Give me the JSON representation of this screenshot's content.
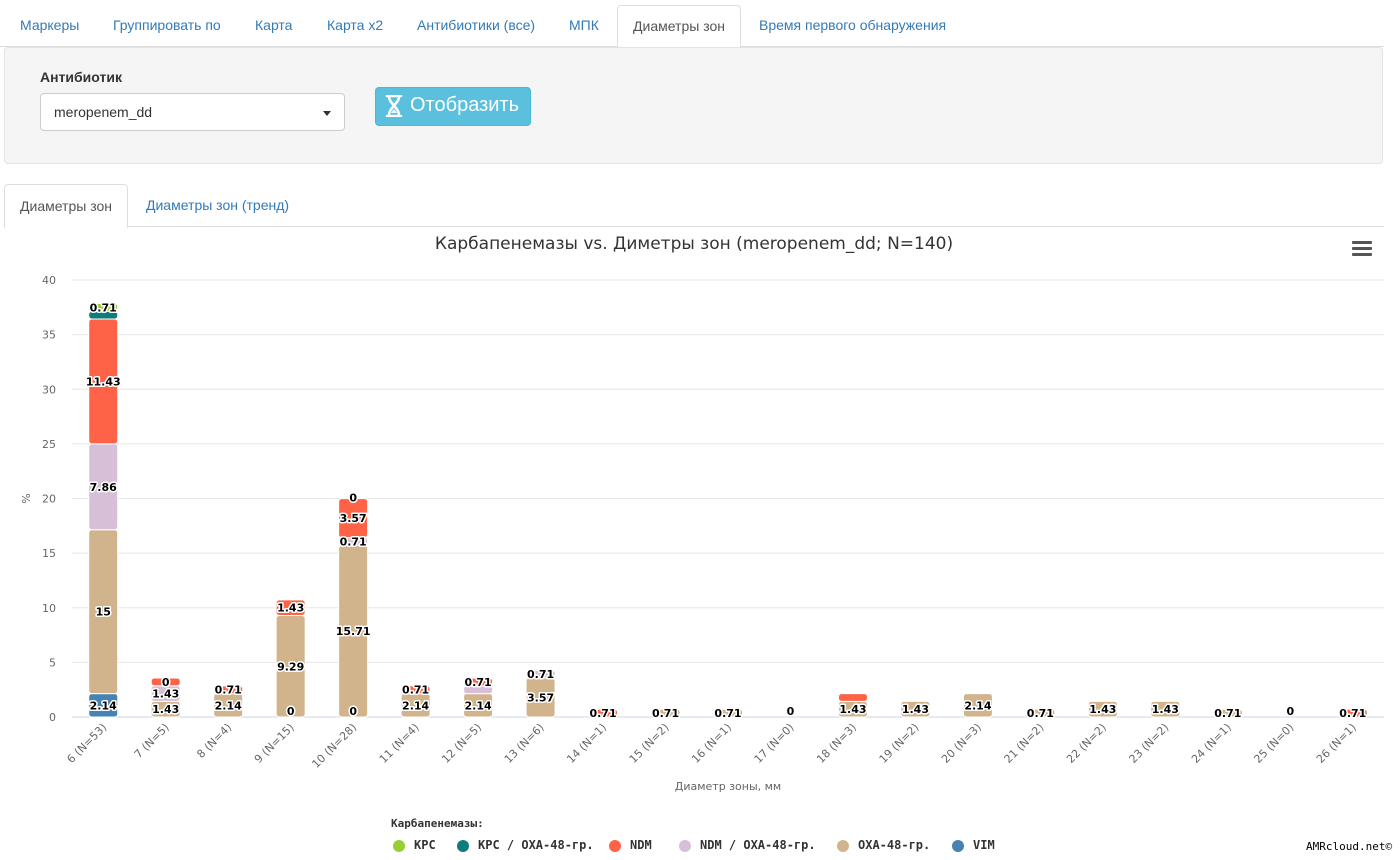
{
  "top_tabs": [
    {
      "label": "Маркеры",
      "active": false
    },
    {
      "label": "Группировать по",
      "active": false
    },
    {
      "label": "Карта",
      "active": false
    },
    {
      "label": "Карта х2",
      "active": false
    },
    {
      "label": "Антибиотики (все)",
      "active": false
    },
    {
      "label": "МПК",
      "active": false
    },
    {
      "label": "Диаметры зон",
      "active": true
    },
    {
      "label": "Время первого обнаружения",
      "active": false
    }
  ],
  "panel": {
    "antibiotic_label": "Антибиотик",
    "antibiotic_value": "meropenem_dd",
    "show_button_label": "Отобразить",
    "show_button_icon": "hourglass-icon"
  },
  "sub_tabs": [
    {
      "label": "Диаметры зон",
      "active": true
    },
    {
      "label": "Диаметры зон (тренд)",
      "active": false
    }
  ],
  "menu_icon": "hamburger-menu-icon",
  "credits": "AMRcloud.net©",
  "chart_data": {
    "type": "bar",
    "stacked": true,
    "title": "Карбапенемазы vs. Диметры зон (meropenem_dd; N=140)",
    "xlabel": "Диаметр зоны, мм",
    "ylabel": "%",
    "ylim": [
      0,
      40
    ],
    "yticks": [
      0,
      5,
      10,
      15,
      20,
      25,
      30,
      35,
      40
    ],
    "grid": true,
    "legend_title": "Карбапенемазы:",
    "legend_position": "bottom",
    "categories": [
      "6 (N=53)",
      "7 (N=5)",
      "8 (N=4)",
      "9 (N=15)",
      "10 (N=28)",
      "11 (N=4)",
      "12 (N=5)",
      "13 (N=6)",
      "14 (N=1)",
      "15 (N=2)",
      "16 (N=1)",
      "17 (N=0)",
      "18 (N=3)",
      "19 (N=2)",
      "20 (N=3)",
      "21 (N=2)",
      "22 (N=2)",
      "23 (N=2)",
      "24 (N=1)",
      "25 (N=0)",
      "26 (N=1)"
    ],
    "series": [
      {
        "name": "VIM",
        "color": "#4682b4",
        "values": [
          2.14,
          0,
          0,
          0,
          0,
          0,
          0,
          0,
          0,
          0,
          0,
          0,
          0,
          0,
          0,
          0,
          0,
          0,
          0,
          0,
          0
        ]
      },
      {
        "name": "OXA-48-гр.",
        "color": "#d2b48c",
        "values": [
          15,
          1.43,
          2.14,
          9.29,
          15.71,
          2.14,
          2.14,
          3.57,
          0,
          0.71,
          0.71,
          0,
          1.43,
          1.43,
          2.14,
          0.71,
          1.43,
          1.43,
          0.71,
          0,
          0
        ]
      },
      {
        "name": "NDM / OXA-48-гр.",
        "color": "#d8bfd8",
        "values": [
          7.86,
          1.43,
          0,
          0,
          0.71,
          0,
          0.71,
          0.71,
          0,
          0,
          0,
          0,
          0,
          0,
          0,
          0,
          0,
          0,
          0,
          0,
          0
        ]
      },
      {
        "name": "NDM",
        "color": "#ff6347",
        "values": [
          11.43,
          0.71,
          0.71,
          1.43,
          3.57,
          0.71,
          0.71,
          0,
          0.71,
          0,
          0,
          0,
          0.71,
          0,
          0,
          0,
          0,
          0,
          0,
          0,
          0.71
        ]
      },
      {
        "name": "KPC / OXA-48-гр.",
        "color": "#0e7c7b",
        "values": [
          0.71,
          0,
          0,
          0,
          0,
          0,
          0,
          0,
          0,
          0,
          0,
          0,
          0,
          0,
          0,
          0,
          0,
          0,
          0,
          0,
          0
        ]
      },
      {
        "name": "KPC",
        "color": "#9acd32",
        "values": [
          0.71,
          0,
          0,
          0,
          0,
          0,
          0,
          0,
          0,
          0,
          0,
          0,
          0,
          0,
          0,
          0,
          0,
          0,
          0,
          0,
          0
        ]
      }
    ],
    "data_labels": [
      [
        {
          "series": 0,
          "text": "2.14"
        },
        {
          "series": 1,
          "text": "15"
        },
        {
          "series": 2,
          "text": "7.86"
        },
        {
          "series": 3,
          "text": "11.43"
        },
        {
          "series": 5,
          "text": "0.71"
        }
      ],
      [
        {
          "series": 1,
          "text": "1.43"
        },
        {
          "series": 2,
          "text": "1.43"
        },
        {
          "series": 3,
          "text": "0"
        }
      ],
      [
        {
          "series": 1,
          "text": "2.14"
        },
        {
          "series": 3,
          "text": "0.71"
        }
      ],
      [
        {
          "series": 1,
          "text": "0"
        },
        {
          "series": 1,
          "text": "9.29"
        },
        {
          "series": 3,
          "text": "1.43"
        }
      ],
      [
        {
          "series": 1,
          "text": "0"
        },
        {
          "series": 1,
          "text": "15.71"
        },
        {
          "series": 2,
          "text": "0.71"
        },
        {
          "series": 3,
          "text": "3.57"
        },
        {
          "series": 3,
          "text": "0"
        }
      ],
      [
        {
          "series": 1,
          "text": "2.14"
        },
        {
          "series": 3,
          "text": "0.71"
        }
      ],
      [
        {
          "series": 1,
          "text": "2.14"
        },
        {
          "series": 3,
          "text": "0.71"
        }
      ],
      [
        {
          "series": 1,
          "text": "3.57"
        },
        {
          "series": 2,
          "text": "0.71"
        }
      ],
      [
        {
          "series": 3,
          "text": "0.71"
        }
      ],
      [
        {
          "series": 1,
          "text": "0.71"
        }
      ],
      [
        {
          "series": 1,
          "text": "0.71"
        }
      ],
      [
        {
          "series": -1,
          "text": "0"
        }
      ],
      [
        {
          "series": 1,
          "text": "1.43"
        }
      ],
      [
        {
          "series": 1,
          "text": "1.43"
        }
      ],
      [
        {
          "series": 1,
          "text": "2.14"
        }
      ],
      [
        {
          "series": 1,
          "text": "0.71"
        }
      ],
      [
        {
          "series": 1,
          "text": "1.43"
        }
      ],
      [
        {
          "series": 1,
          "text": "1.43"
        }
      ],
      [
        {
          "series": 1,
          "text": "0.71"
        }
      ],
      [
        {
          "series": -1,
          "text": "0"
        }
      ],
      [
        {
          "series": 3,
          "text": "0.71"
        }
      ]
    ]
  }
}
